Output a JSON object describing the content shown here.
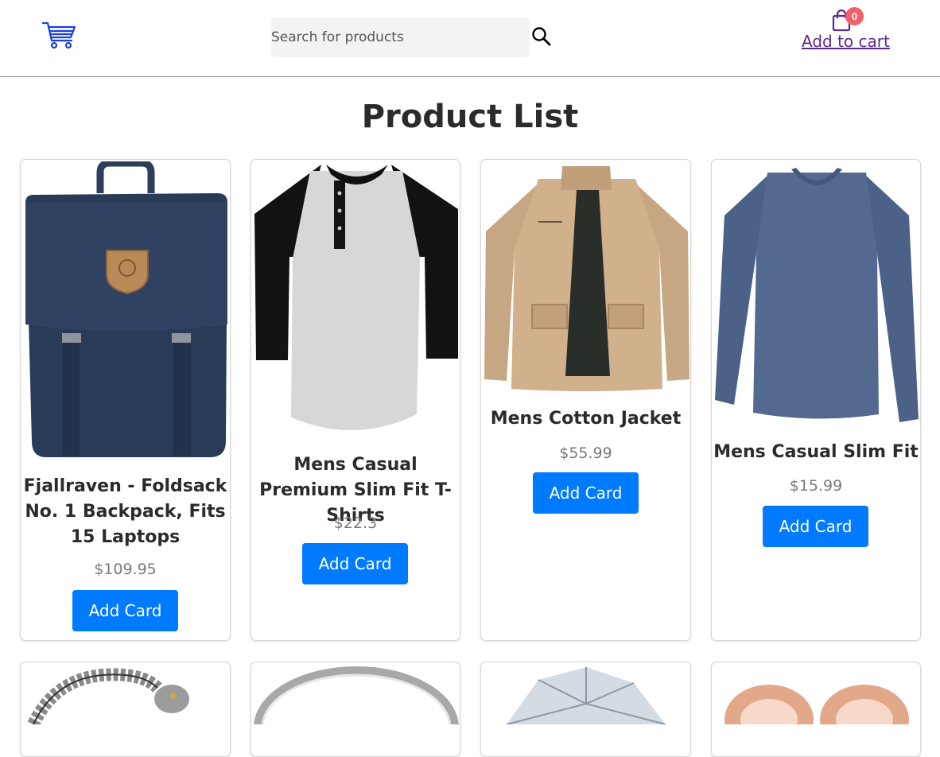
{
  "header": {
    "search": {
      "placeholder": "Search for products"
    },
    "cart": {
      "count": "0",
      "link_label": "Add to cart"
    }
  },
  "page": {
    "title": "Product List"
  },
  "products": [
    {
      "title": "Fjallraven - Foldsack No. 1 Backpack, Fits 15 Laptops",
      "price": "$109.95",
      "button": "Add Card"
    },
    {
      "title": "Mens Casual Premium Slim Fit T-Shirts",
      "price": "$22.3",
      "button": "Add Card"
    },
    {
      "title": "Mens Cotton Jacket",
      "price": "$55.99",
      "button": "Add Card"
    },
    {
      "title": "Mens Casual Slim Fit",
      "price": "$15.99",
      "button": "Add Card"
    }
  ],
  "icons": {
    "logo": "shopping-cart-icon",
    "search": "search-icon",
    "cart": "shopping-bag-icon"
  },
  "colors": {
    "accent": "#007bff",
    "logo": "#1a3fe0",
    "badge": "#f0616a",
    "link": "#5a2a8a"
  }
}
